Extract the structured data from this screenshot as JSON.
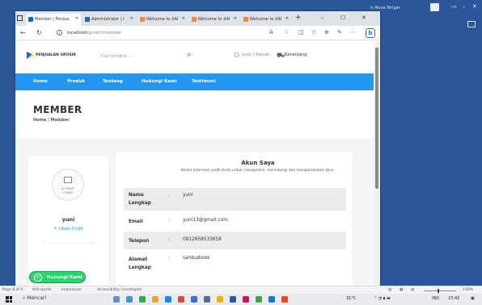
{
  "colors": {
    "brand_blue": "#2196f3",
    "whatsapp_green": "#2dd36f"
  },
  "background_window": {
    "title": "ls Nova Tengar"
  },
  "browser": {
    "tabs": [
      {
        "label": "Member | Penjua",
        "active": true,
        "favicon_color": "#1565c0"
      },
      {
        "label": "Administrator | I",
        "active": false,
        "favicon_color": "#1565c0"
      },
      {
        "label": "Welcome to XAI",
        "active": false,
        "favicon_color": "#f28b30"
      },
      {
        "label": "Welcome to XAI",
        "active": false,
        "favicon_color": "#f28b30"
      },
      {
        "label": "Welcome to XAI",
        "active": false,
        "favicon_color": "#f28b30"
      }
    ],
    "url": {
      "host": "localhost",
      "path": "/grosir/member"
    }
  },
  "site": {
    "logo": "PENJUALAN GROSIR",
    "search_placeholder": "Cari produk ...",
    "user": "yuni",
    "logout": "Keluar",
    "cart": "Keranjang",
    "nav": [
      "Home",
      "Produk",
      "Tentang",
      "Hubungi Kami",
      "Testimoni"
    ]
  },
  "page": {
    "title": "MEMBER",
    "breadcrumb": "Home / Member"
  },
  "profile_card": {
    "no_image_line1": "NO IMAGE",
    "no_image_line2": "FOUND",
    "name": "yuni",
    "edit": "Ubah Profil"
  },
  "account": {
    "title": "Akun Saya",
    "subtitle": "Kelola informasi profil Anda untuk mengontrol, melindungi dan mengamankan akun.",
    "rows": [
      {
        "label": "Nama Lengkap",
        "value": "yuni"
      },
      {
        "label": "Email",
        "value": "yuni13@gmail.com"
      },
      {
        "label": "Telepon",
        "value": "0812658533658"
      },
      {
        "label": "Alamat Lengkap",
        "value": "saribudolok"
      }
    ]
  },
  "whatsapp": {
    "label": "Hubungi Kami"
  },
  "word_status": {
    "page": "Page 8 of 9",
    "words": "640 words",
    "language": "Indonesian",
    "accessibility": "Accessibility: Investigate",
    "zoom": "100%"
  },
  "taskbar": {
    "search": "Mencari",
    "weather": "31°C",
    "lang": "IND",
    "time": "23:42"
  }
}
